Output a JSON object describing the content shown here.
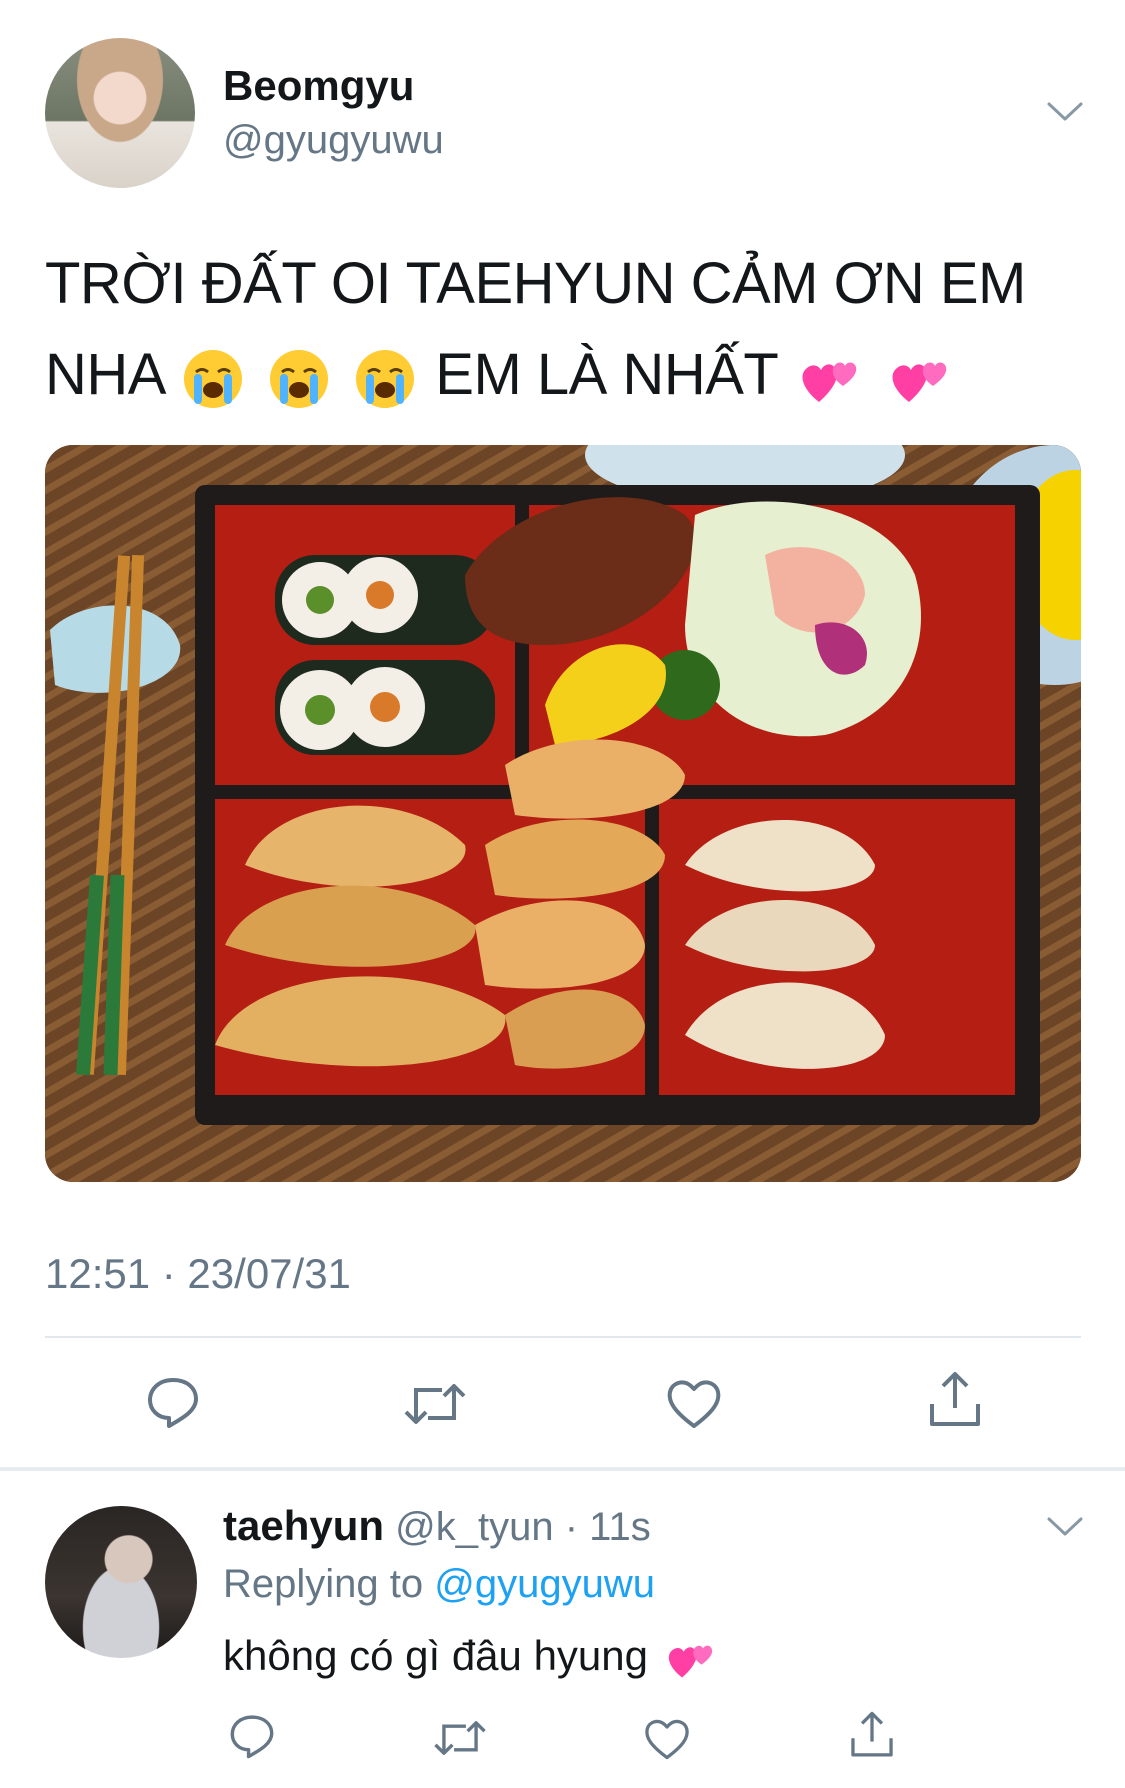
{
  "tweet": {
    "author": {
      "display_name": "Beomgyu",
      "handle": "@gyugyuwu"
    },
    "text_line1": "TRỜI ĐẤT OI TAEHYUN CẢM ƠN EM",
    "text_line2_a": "NHA",
    "text_line2_b": "EM LÀ NHẤT",
    "emojis": [
      "loudly-crying-face",
      "loudly-crying-face",
      "loudly-crying-face",
      "two-hearts",
      "two-hearts"
    ],
    "media_description_icon": "bento-box-photo",
    "timestamp": "12:51 · 23/07/31",
    "actions": [
      "reply-icon",
      "retweet-icon",
      "like-icon",
      "share-icon"
    ]
  },
  "reply": {
    "author": {
      "display_name": "taehyun",
      "handle": "@k_tyun",
      "time": "· 11s"
    },
    "replying_prefix": "Replying to",
    "replying_to": "@gyugyuwu",
    "text": "không có gì đâu hyung",
    "emoji": "two-hearts"
  },
  "colors": {
    "text_primary": "#14171a",
    "text_secondary": "#657786",
    "link": "#1da1f2",
    "divider": "#e1e8ed"
  }
}
